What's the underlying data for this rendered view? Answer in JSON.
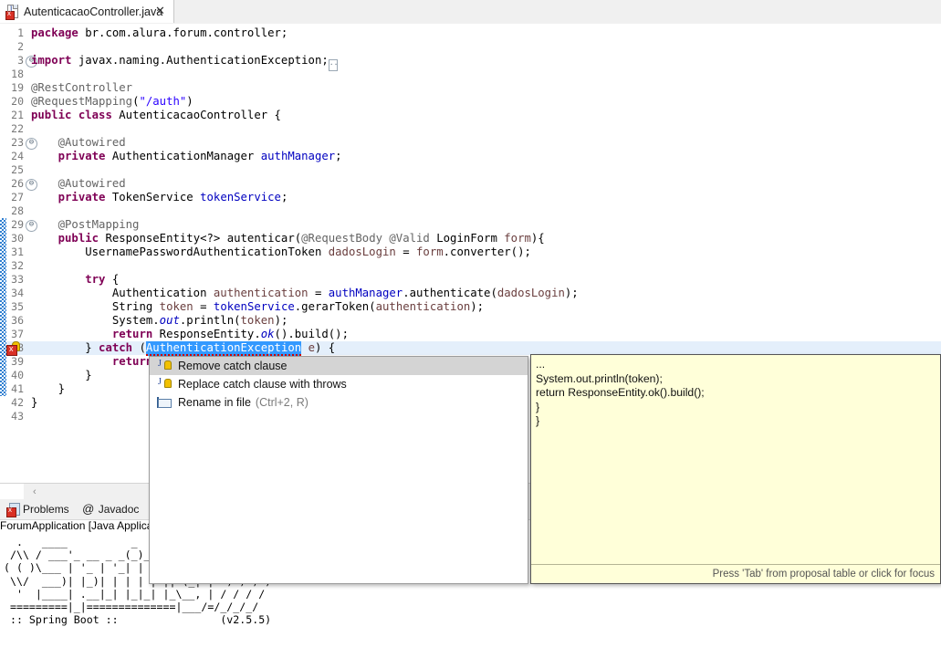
{
  "tab": {
    "title": "AutenticacaoController.java",
    "close_label": "✕",
    "icon": "java-file-error-icon"
  },
  "editor": {
    "lines": [
      {
        "num": "1",
        "fold": false,
        "error": false,
        "changed": false,
        "html": "<span class=\"kw\">package</span> br.com.alura.forum.controller;"
      },
      {
        "num": "2",
        "fold": false,
        "error": false,
        "changed": false,
        "html": ""
      },
      {
        "num": "3",
        "fold": true,
        "error": false,
        "changed": false,
        "html": "<span class=\"kw\">import</span> javax.naming.AuthenticationException;<span class=\"collapsed-box\"></span>"
      },
      {
        "num": "18",
        "fold": false,
        "error": false,
        "changed": false,
        "html": ""
      },
      {
        "num": "19",
        "fold": false,
        "error": false,
        "changed": false,
        "html": "<span class=\"ann\">@RestController</span>"
      },
      {
        "num": "20",
        "fold": false,
        "error": false,
        "changed": false,
        "html": "<span class=\"ann\">@RequestMapping</span>(<span class=\"str\">\"/auth\"</span>)"
      },
      {
        "num": "21",
        "fold": false,
        "error": false,
        "changed": false,
        "html": "<span class=\"kw\">public</span> <span class=\"kw\">class</span> AutenticacaoController {"
      },
      {
        "num": "22",
        "fold": false,
        "error": false,
        "changed": false,
        "html": ""
      },
      {
        "num": "23",
        "fold": true,
        "error": false,
        "changed": false,
        "html": "    <span class=\"ann\">@Autowired</span>"
      },
      {
        "num": "24",
        "fold": false,
        "error": false,
        "changed": false,
        "html": "    <span class=\"kw\">private</span> AuthenticationManager <span class=\"fld\">authManager</span>;"
      },
      {
        "num": "25",
        "fold": false,
        "error": false,
        "changed": false,
        "html": ""
      },
      {
        "num": "26",
        "fold": true,
        "error": false,
        "changed": false,
        "html": "    <span class=\"ann\">@Autowired</span>"
      },
      {
        "num": "27",
        "fold": false,
        "error": false,
        "changed": false,
        "html": "    <span class=\"kw\">private</span> TokenService <span class=\"fld\">tokenService</span>;"
      },
      {
        "num": "28",
        "fold": false,
        "error": false,
        "changed": false,
        "html": ""
      },
      {
        "num": "29",
        "fold": true,
        "error": false,
        "changed": true,
        "html": "    <span class=\"ann\">@PostMapping</span>"
      },
      {
        "num": "30",
        "fold": false,
        "error": false,
        "changed": true,
        "html": "    <span class=\"kw\">public</span> ResponseEntity&lt;?&gt; autenticar(<span class=\"ann\">@RequestBody</span> <span class=\"ann\">@Valid</span> LoginForm <span class=\"loc\">form</span>){"
      },
      {
        "num": "31",
        "fold": false,
        "error": false,
        "changed": true,
        "html": "        UsernamePasswordAuthenticationToken <span class=\"loc\">dadosLogin</span> = <span class=\"loc\">form</span>.converter();"
      },
      {
        "num": "32",
        "fold": false,
        "error": false,
        "changed": true,
        "html": ""
      },
      {
        "num": "33",
        "fold": false,
        "error": false,
        "changed": true,
        "html": "        <span class=\"kw\">try</span> {"
      },
      {
        "num": "34",
        "fold": false,
        "error": false,
        "changed": true,
        "html": "            Authentication <span class=\"loc\">authentication</span> = <span class=\"fld\">authManager</span>.authenticate(<span class=\"loc\">dadosLogin</span>);"
      },
      {
        "num": "35",
        "fold": false,
        "error": false,
        "changed": true,
        "html": "            String <span class=\"loc\">token</span> = <span class=\"fld\">tokenService</span>.gerarToken(<span class=\"loc\">authentication</span>);"
      },
      {
        "num": "36",
        "fold": false,
        "error": false,
        "changed": true,
        "html": "            System.<span class=\"stat\">out</span>.println(<span class=\"loc\">token</span>);"
      },
      {
        "num": "37",
        "fold": false,
        "error": false,
        "changed": true,
        "html": "            <span class=\"kw\">return</span> ResponseEntity.<span class=\"stat\">ok</span>().build();"
      },
      {
        "num": "38",
        "fold": false,
        "error": true,
        "changed": true,
        "highlight": true,
        "html": "        } <span class=\"kw\">catch</span> (<span class=\"sel squig\">AuthenticationException</span> <span class=\"loc\">e</span>) {"
      },
      {
        "num": "39",
        "fold": false,
        "error": false,
        "changed": true,
        "html": "            <span class=\"kw\">return</span>"
      },
      {
        "num": "40",
        "fold": false,
        "error": false,
        "changed": true,
        "html": "        }"
      },
      {
        "num": "41",
        "fold": false,
        "error": false,
        "changed": true,
        "html": "    }"
      },
      {
        "num": "42",
        "fold": false,
        "error": false,
        "changed": false,
        "html": "}"
      },
      {
        "num": "43",
        "fold": false,
        "error": false,
        "changed": false,
        "html": ""
      }
    ],
    "scroll_left_arrow": "‹"
  },
  "quickfix": {
    "items": [
      {
        "label": "Remove catch clause",
        "shortcut": "",
        "icon": "quickfix-icon",
        "selected": true
      },
      {
        "label": "Replace catch clause with throws",
        "shortcut": "",
        "icon": "quickfix-icon",
        "selected": false
      },
      {
        "label": "Rename in file",
        "shortcut": "(Ctrl+2, R)",
        "icon": "rename-icon",
        "selected": false
      }
    ]
  },
  "preview": {
    "body": "...\nSystem.out.println(token);\nreturn ResponseEntity.ok().build();\n}\n}",
    "footer": "Press 'Tab' from proposal table or click for focus"
  },
  "bottom": {
    "tabs": [
      {
        "label": "Problems",
        "icon": "problems-icon"
      },
      {
        "label": "Javadoc",
        "icon": "at-icon"
      },
      {
        "label": "",
        "icon": "declaration-icon"
      }
    ],
    "console_header": "ForumApplication [Java Applica",
    "console_text": "  .   ____          _            __ _ _\n /\\\\ / ___'_ __ _ _(_)_ __  __ _ \\ \\ \\ \\\n( ( )\\___ | '_ | '_| | '_ \\/ _` | \\ \\ \\ \\\n \\\\/  ___)| |_)| | | | | || (_| |  ) ) ) )\n  '  |____| .__|_| |_|_| |_\\__, | / / / /\n =========|_|==============|___/=/_/_/_/\n :: Spring Boot ::                (v2.5.5)"
  },
  "colors": {
    "keyword": "#7f0055",
    "string": "#2a00ff",
    "field": "#0000c0",
    "annotation": "#646464",
    "selection": "#3399ff",
    "error": "#d93025",
    "row_highlight": "#e4effb",
    "changebar": "#2f7fd1",
    "tooltip_bg": "#ffffd9"
  }
}
